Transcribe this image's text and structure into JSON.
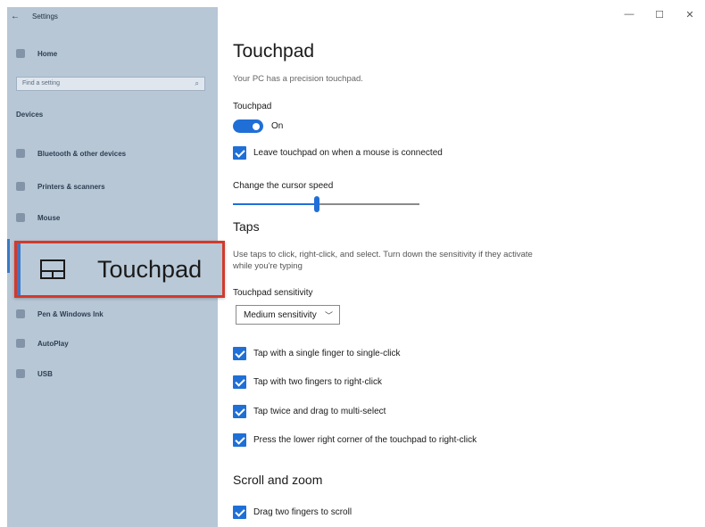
{
  "window": {
    "back_glyph": "←",
    "title": "Settings",
    "minimize": "—",
    "maximize": "☐",
    "close": "✕"
  },
  "sidebar": {
    "home": "Home",
    "search_placeholder": "Find a setting",
    "section": "Devices",
    "items": [
      {
        "label": "Bluetooth & other devices"
      },
      {
        "label": "Printers & scanners"
      },
      {
        "label": "Mouse"
      },
      {
        "label": "Touchpad"
      },
      {
        "label": "Pen & Windows Ink"
      },
      {
        "label": "AutoPlay"
      },
      {
        "label": "USB"
      }
    ],
    "selected_callout_label": "Touchpad"
  },
  "main": {
    "title": "Touchpad",
    "subtitle": "Your PC has a precision touchpad.",
    "touchpad_label": "Touchpad",
    "toggle_state": "On",
    "leave_on_label": "Leave touchpad on when a mouse is connected",
    "cursor_speed_label": "Change the cursor speed",
    "cursor_speed_value": 0.45,
    "taps_heading": "Taps",
    "taps_description": "Use taps to click, right-click, and select. Turn down the sensitivity if they activate while you're typing",
    "sensitivity_label": "Touchpad sensitivity",
    "sensitivity_value": "Medium sensitivity",
    "tap_options": [
      "Tap with a single finger to single-click",
      "Tap with two fingers to right-click",
      "Tap twice and drag to multi-select",
      "Press the lower right corner of the touchpad to right-click"
    ],
    "scroll_heading": "Scroll and zoom",
    "scroll_option": "Drag two fingers to scroll"
  },
  "colors": {
    "accent": "#1f6fd6",
    "highlight_border": "#d23a2c",
    "sidebar_bg": "#b7c7d6"
  }
}
